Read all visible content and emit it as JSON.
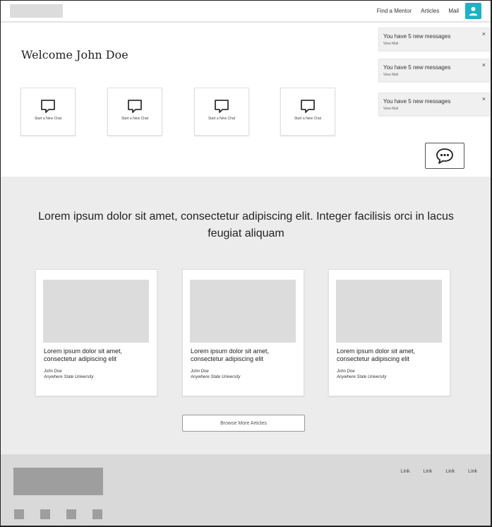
{
  "header": {
    "nav": [
      "Find a Mentor",
      "Articles",
      "Mail"
    ]
  },
  "welcome": "Welcome John Doe",
  "chat_tiles": [
    "Start a New Chat",
    "Start a New Chat",
    "Start a New Chat",
    "Start a New Chat"
  ],
  "notifications": [
    {
      "message": "You have 5 new messages",
      "link": "View Mail"
    },
    {
      "message": "You have 5 new messages",
      "link": "View Mail"
    },
    {
      "message": "You have 5 new messages",
      "link": "View Mail"
    }
  ],
  "close_glyph": "×",
  "articles": {
    "headline": "Lorem ipsum dolor sit amet, consectetur adipiscing elit. Integer facilisis orci in lacus feugiat aliquam",
    "cards": [
      {
        "title": "Lorem ipsum dolor sit amet, consectetur adipiscing elit",
        "author": "John Doe",
        "university": "Anywhere State University"
      },
      {
        "title": "Lorem ipsum dolor sit amet, consectetur adipiscing elit",
        "author": "John Doe",
        "university": "Anywhere State University"
      },
      {
        "title": "Lorem ipsum dolor sit amet, consectetur adipiscing elit",
        "author": "John Doe",
        "university": "Anywhere State University"
      }
    ],
    "browse_label": "Browse More Articles"
  },
  "footer": {
    "links": [
      "Link",
      "Link",
      "Link",
      "Link"
    ]
  },
  "colors": {
    "accent": "#1fb1c5",
    "section_bg": "#ececec",
    "footer_bg": "#d9d9d9",
    "placeholder": "#dcdcdc"
  },
  "icons": {
    "avatar": "user-icon",
    "chat_tile": "speech-bubble-icon",
    "chat_fab": "chat-dots-icon",
    "close": "close-icon"
  }
}
